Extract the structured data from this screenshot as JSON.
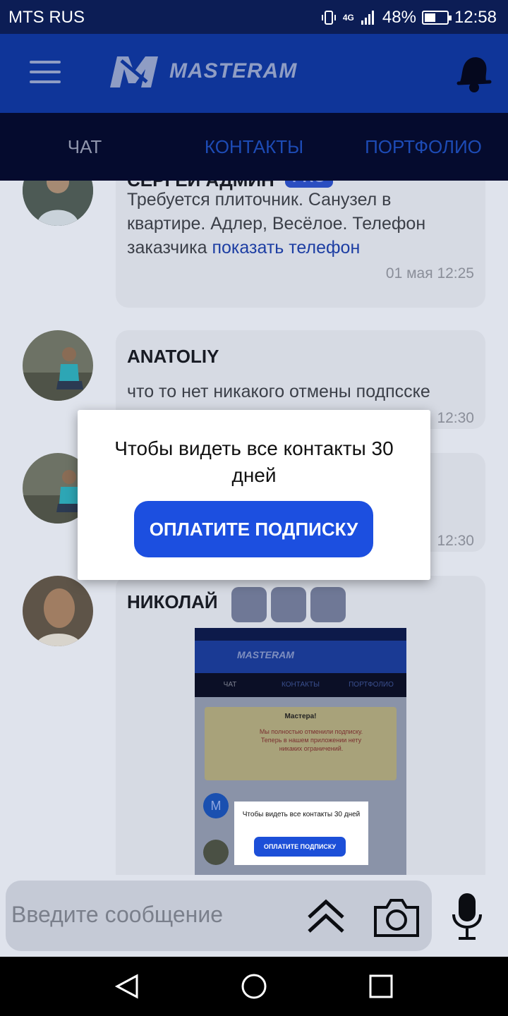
{
  "status_bar": {
    "carrier": "MTS RUS",
    "network": "4G",
    "battery": "48%",
    "time": "12:58"
  },
  "header": {
    "logo_text": "MASTERAM"
  },
  "tabs": [
    {
      "label": "ЧАТ"
    },
    {
      "label": "КОНТАКТЫ"
    },
    {
      "label": "ПОРТФОЛИО"
    }
  ],
  "messages": [
    {
      "author": "СЕРГЕЙ АДМИН",
      "badge": "PRO",
      "text": "Требуется плиточник. Санузел в квартире. Адлер, Весёлое. Телефон заказчика",
      "link_text": "показать телефон",
      "time": "01 мая 12:25"
    },
    {
      "author": "ANATOLIY",
      "text": "что то нет никакого отмены подпсске",
      "time": "12:30"
    },
    {
      "time": "12:30"
    },
    {
      "author": "НИКОЛАЙ"
    }
  ],
  "embedded_screenshot": {
    "tabs": [
      "ЧАТ",
      "КОНТАКТЫ",
      "ПОРТФОЛИО"
    ],
    "notice_title": "Мастера!",
    "notice_text": "Мы полностью отменили подписку. Теперь в нашем приложении нету никаких ограничений.",
    "dialog_text": "Чтобы видеть все  контакты 30 дней",
    "dialog_button": "ОПЛАТИТЕ ПОДПИСКУ"
  },
  "composer": {
    "placeholder": "Введите сообщение"
  },
  "dialog": {
    "text": "Чтобы видеть все  контакты 30 дней",
    "button": "ОПЛАТИТЕ ПОДПИСКУ"
  }
}
